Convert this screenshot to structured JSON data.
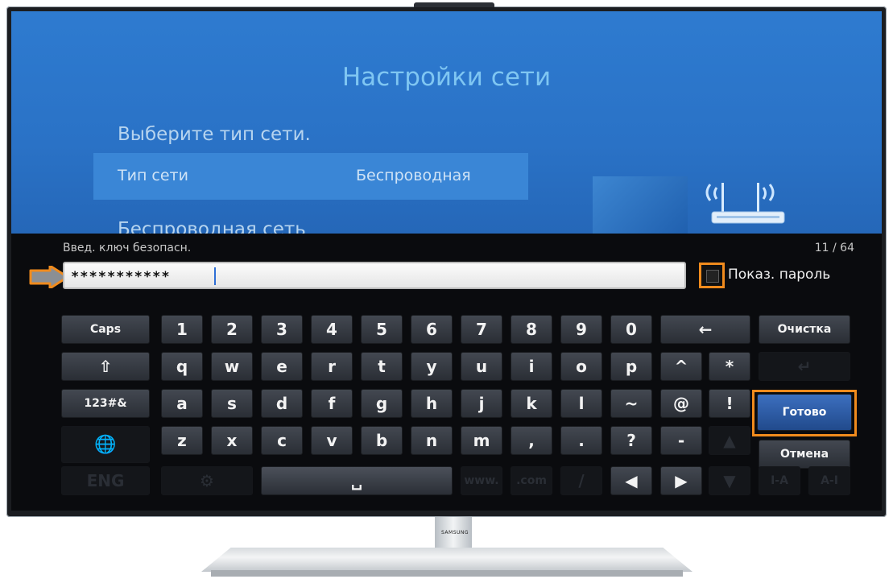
{
  "settings": {
    "title": "Настройки сети",
    "subtitle": "Выберите тип сети.",
    "network_type_label": "Тип сети",
    "network_type_value": "Беспроводная",
    "wireless_label": "Беспроводная сеть"
  },
  "keyboard": {
    "hint": "Введ. ключ безопасн.",
    "counter": "11 / 64",
    "password_masked": "***********",
    "show_password_label": "Показ. пароль",
    "row1": [
      "Caps",
      "1",
      "2",
      "3",
      "4",
      "5",
      "6",
      "7",
      "8",
      "9",
      "0",
      "←",
      "Очистка"
    ],
    "row2": [
      "⇧",
      "q",
      "w",
      "e",
      "r",
      "t",
      "y",
      "u",
      "i",
      "o",
      "p",
      "^",
      "*",
      "↵"
    ],
    "row3": [
      "123#&",
      "a",
      "s",
      "d",
      "f",
      "g",
      "h",
      "j",
      "k",
      "l",
      "~",
      "@",
      "!",
      "Готово"
    ],
    "row4": [
      "z",
      "x",
      "c",
      "v",
      "b",
      "n",
      "m",
      ",",
      ".",
      "?",
      "-",
      "▲",
      "Отмена"
    ],
    "row5": [
      "ENG",
      "⚙",
      "␣",
      "www.",
      ".com",
      "/",
      "◀",
      "▶",
      "▼",
      "I-A",
      "A-I"
    ],
    "globe": "🌐"
  },
  "brand": "SAMSUNG",
  "colors": {
    "highlight": "#f08b1d",
    "screen_blue": "#2e7bd0",
    "done_key": "#2f5ea8"
  }
}
